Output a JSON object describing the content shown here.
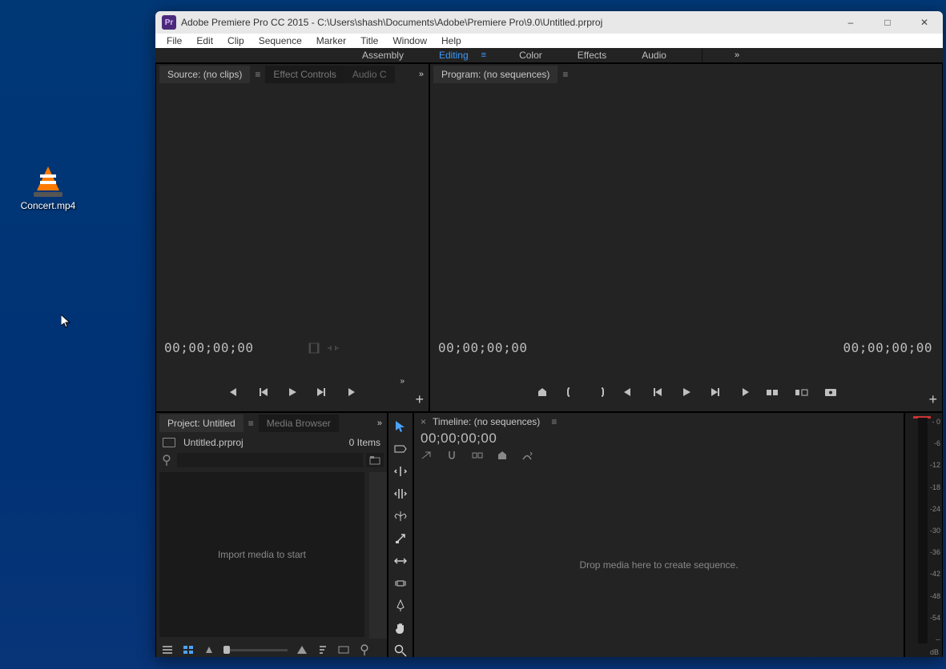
{
  "desktop": {
    "file_label": "Concert.mp4"
  },
  "window": {
    "app_icon_text": "Pr",
    "title": "Adobe Premiere Pro CC 2015 - C:\\Users\\shash\\Documents\\Adobe\\Premiere Pro\\9.0\\Untitled.prproj"
  },
  "menu": [
    "File",
    "Edit",
    "Clip",
    "Sequence",
    "Marker",
    "Title",
    "Window",
    "Help"
  ],
  "workspaces": [
    "Assembly",
    "Editing",
    "Color",
    "Effects",
    "Audio"
  ],
  "active_workspace": "Editing",
  "source_panel": {
    "tab_source": "Source: (no clips)",
    "tab_effect_controls": "Effect Controls",
    "tab_audio_clip": "Audio C",
    "timecode": "00;00;00;00"
  },
  "program_panel": {
    "tab_program": "Program: (no sequences)",
    "timecode_left": "00;00;00;00",
    "timecode_right": "00;00;00;00"
  },
  "project_panel": {
    "tab_project": "Project: Untitled",
    "tab_media_browser": "Media Browser",
    "project_file": "Untitled.prproj",
    "item_count": "0 Items",
    "drop_hint": "Import media to start"
  },
  "timeline_panel": {
    "tab_timeline": "Timeline: (no sequences)",
    "timecode": "00;00;00;00",
    "drop_hint": "Drop media here to create sequence."
  },
  "meter_ticks": [
    "- 0",
    "-6",
    "-12",
    "-18",
    "-24",
    "-30",
    "-36",
    "-42",
    "-48",
    "-54",
    "--"
  ],
  "db_label": "dB"
}
